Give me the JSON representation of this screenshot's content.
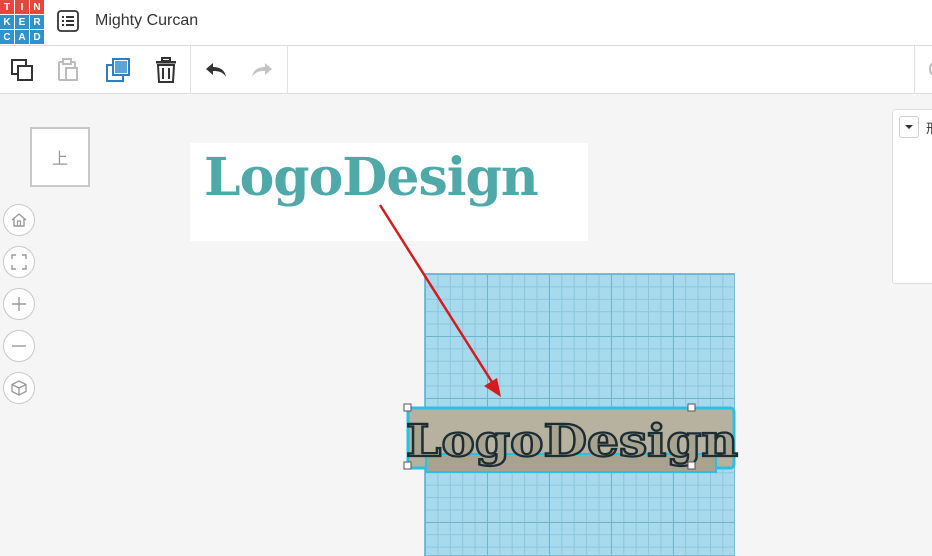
{
  "app": {
    "logo_letters": [
      "T",
      "I",
      "N",
      "K",
      "E",
      "R",
      "C",
      "A",
      "D"
    ],
    "logo_colors": [
      "#e2483d",
      "#e2483d",
      "#e2483d",
      "#2e92cc",
      "#2e92cc",
      "#2e92cc",
      "#2e92cc",
      "#2e92cc",
      "#2e92cc"
    ],
    "project_title": "Mighty Curcan"
  },
  "toolbar": {
    "buttons": [
      {
        "name": "copy-icon",
        "enabled": true
      },
      {
        "name": "paste-icon",
        "enabled": false
      },
      {
        "name": "duplicate-icon",
        "enabled": true
      },
      {
        "name": "trash-icon",
        "enabled": true
      },
      {
        "name": "undo-icon",
        "enabled": true
      },
      {
        "name": "redo-icon",
        "enabled": false
      }
    ]
  },
  "viewcube": {
    "label": "上"
  },
  "nav": {
    "buttons": [
      "home-icon",
      "fit-view-icon",
      "zoom-in-icon",
      "zoom-out-icon",
      "perspective-icon"
    ]
  },
  "shape_panel": {
    "label": "形"
  },
  "canvas": {
    "logo_card_text": "LogoDesign",
    "logo_card_color": "#4fa9a8",
    "model_text": "LogoDesign",
    "grid_color": "#a7daed",
    "selection_color": "#2ac0e6",
    "arrow_color": "#d11d1d"
  }
}
